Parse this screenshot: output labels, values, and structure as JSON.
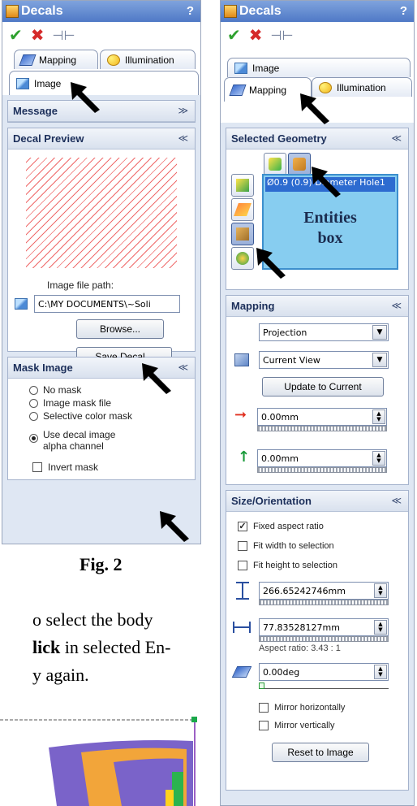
{
  "panel_left": {
    "title": "Decals",
    "help": "?",
    "tabs": [
      {
        "label": "Mapping"
      },
      {
        "label": "Illumination"
      },
      {
        "label": "Image"
      }
    ],
    "message_header": "Message",
    "preview_header": "Decal Preview",
    "image_path_label": "Image file path:",
    "image_path_value": "C:\\MY DOCUMENTS\\~Soli",
    "browse_label": "Browse...",
    "save_decal_label": "Save Decal...",
    "mask_header": "Mask Image",
    "mask_options": [
      {
        "label": "No mask",
        "selected": false
      },
      {
        "label": "Image mask file",
        "selected": false
      },
      {
        "label": "Selective color mask",
        "selected": false
      },
      {
        "label": "Use decal image alpha channel",
        "selected": true
      }
    ],
    "invert_mask_label": "Invert mask",
    "invert_mask_checked": false
  },
  "figure_caption": "Fig. 2",
  "body_text": {
    "line1": "o select the body",
    "line2_bold": "lick",
    "line2_rest": " in selected En-",
    "line3": "y again."
  },
  "panel_right": {
    "title": "Decals",
    "help": "?",
    "tabs": [
      {
        "label": "Image"
      },
      {
        "label": "Mapping"
      },
      {
        "label": "Illumination"
      }
    ],
    "geometry_header": "Selected Geometry",
    "geometry_item": "Ø0.9 (0.9) Diameter Hole1",
    "entities_label_line1": "Entities",
    "entities_label_line2": "box",
    "mapping_header": "Mapping",
    "projection_value": "Projection",
    "view_value": "Current View",
    "update_label": "Update to Current",
    "horizontal_offset": "0.00mm",
    "vertical_offset": "0.00mm",
    "size_header": "Size/Orientation",
    "fixed_aspect_label": "Fixed aspect ratio",
    "fixed_aspect_checked": true,
    "fit_width_label": "Fit width to selection",
    "fit_height_label": "Fit height to selection",
    "height_value": "266.65242746mm",
    "width_value": "77.83528127mm",
    "aspect_ratio_text": "Aspect ratio: 3.43 : 1",
    "rotation_value": "0.00deg",
    "mirror_h_label": "Mirror horizontally",
    "mirror_v_label": "Mirror vertically",
    "reset_label": "Reset to Image"
  },
  "colors": {
    "title_bar": "#4f79c6",
    "ok_check": "#2fa12f",
    "cancel_x": "#d52a2a",
    "preview_stripes": "#ef6b6b",
    "entities_box": "#87cdf0",
    "arrow_h": "#e03020",
    "arrow_v": "#1a9a3a"
  }
}
